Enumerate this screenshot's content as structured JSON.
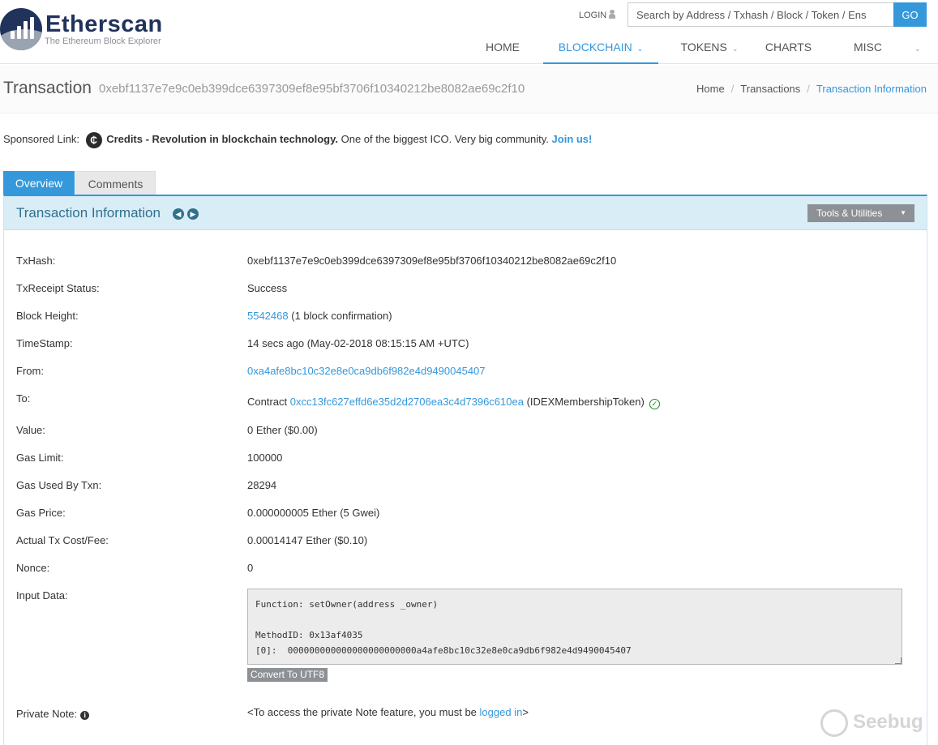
{
  "brand": {
    "name": "Etherscan",
    "tagline": "The Ethereum Block Explorer"
  },
  "header": {
    "login_label": "LOGIN",
    "search_placeholder": "Search by Address / Txhash / Block / Token / Ens",
    "go_label": "GO",
    "nav": {
      "home": "HOME",
      "blockchain": "BLOCKCHAIN",
      "tokens": "TOKENS",
      "charts": "CHARTS",
      "misc": "MISC"
    }
  },
  "titlebar": {
    "title": "Transaction",
    "hash": "0xebf1137e7e9c0eb399dce6397309ef8e95bf3706f10340212be8082ae69c2f10",
    "breadcrumb": [
      "Home",
      "Transactions",
      "Transaction Information"
    ]
  },
  "sponsor": {
    "label": "Sponsored Link:",
    "icon_glyph": "₵",
    "headline": "Credits - Revolution in blockchain technology.",
    "text": "One of the biggest ICO. Very big community.",
    "link": "Join us!"
  },
  "tabs": {
    "overview": "Overview",
    "comments": "Comments"
  },
  "panel": {
    "title": "Transaction Information",
    "tools_label": "Tools & Utilities"
  },
  "tx": {
    "txhash_label": "TxHash:",
    "txhash": "0xebf1137e7e9c0eb399dce6397309ef8e95bf3706f10340212be8082ae69c2f10",
    "status_label": "TxReceipt Status:",
    "status": "Success",
    "block_label": "Block Height:",
    "block": "5542468",
    "block_conf": "(1 block confirmation)",
    "timestamp_label": "TimeStamp:",
    "timestamp": "14 secs ago (May-02-2018 08:15:15 AM +UTC)",
    "from_label": "From:",
    "from": "0xa4afe8bc10c32e8e0ca9db6f982e4d9490045407",
    "to_label": "To:",
    "to_prefix": "Contract",
    "to_address": "0xcc13fc627effd6e35d2d2706ea3c4d7396c610ea",
    "to_name": "(IDEXMembershipToken)",
    "value_label": "Value:",
    "value": "0 Ether ($0.00)",
    "gaslimit_label": "Gas Limit:",
    "gaslimit": "100000",
    "gasused_label": "Gas Used By Txn:",
    "gasused": "28294",
    "gasprice_label": "Gas Price:",
    "gasprice": "0.000000005 Ether (5 Gwei)",
    "fee_label": "Actual Tx Cost/Fee:",
    "fee": "0.00014147 Ether ($0.10)",
    "nonce_label": "Nonce:",
    "nonce": "0",
    "input_label": "Input Data:",
    "input_data": "Function: setOwner(address _owner)\n\nMethodID: 0x13af4035\n[0]:  000000000000000000000000a4afe8bc10c32e8e0ca9db6f982e4d9490045407",
    "convert_label": "Convert To UTF8",
    "note_label": "Private Note:",
    "note_prefix": "<To access the private Note feature, you must be",
    "note_link": "logged in",
    "note_suffix": ">"
  },
  "watermark": {
    "text": "Seebug"
  }
}
